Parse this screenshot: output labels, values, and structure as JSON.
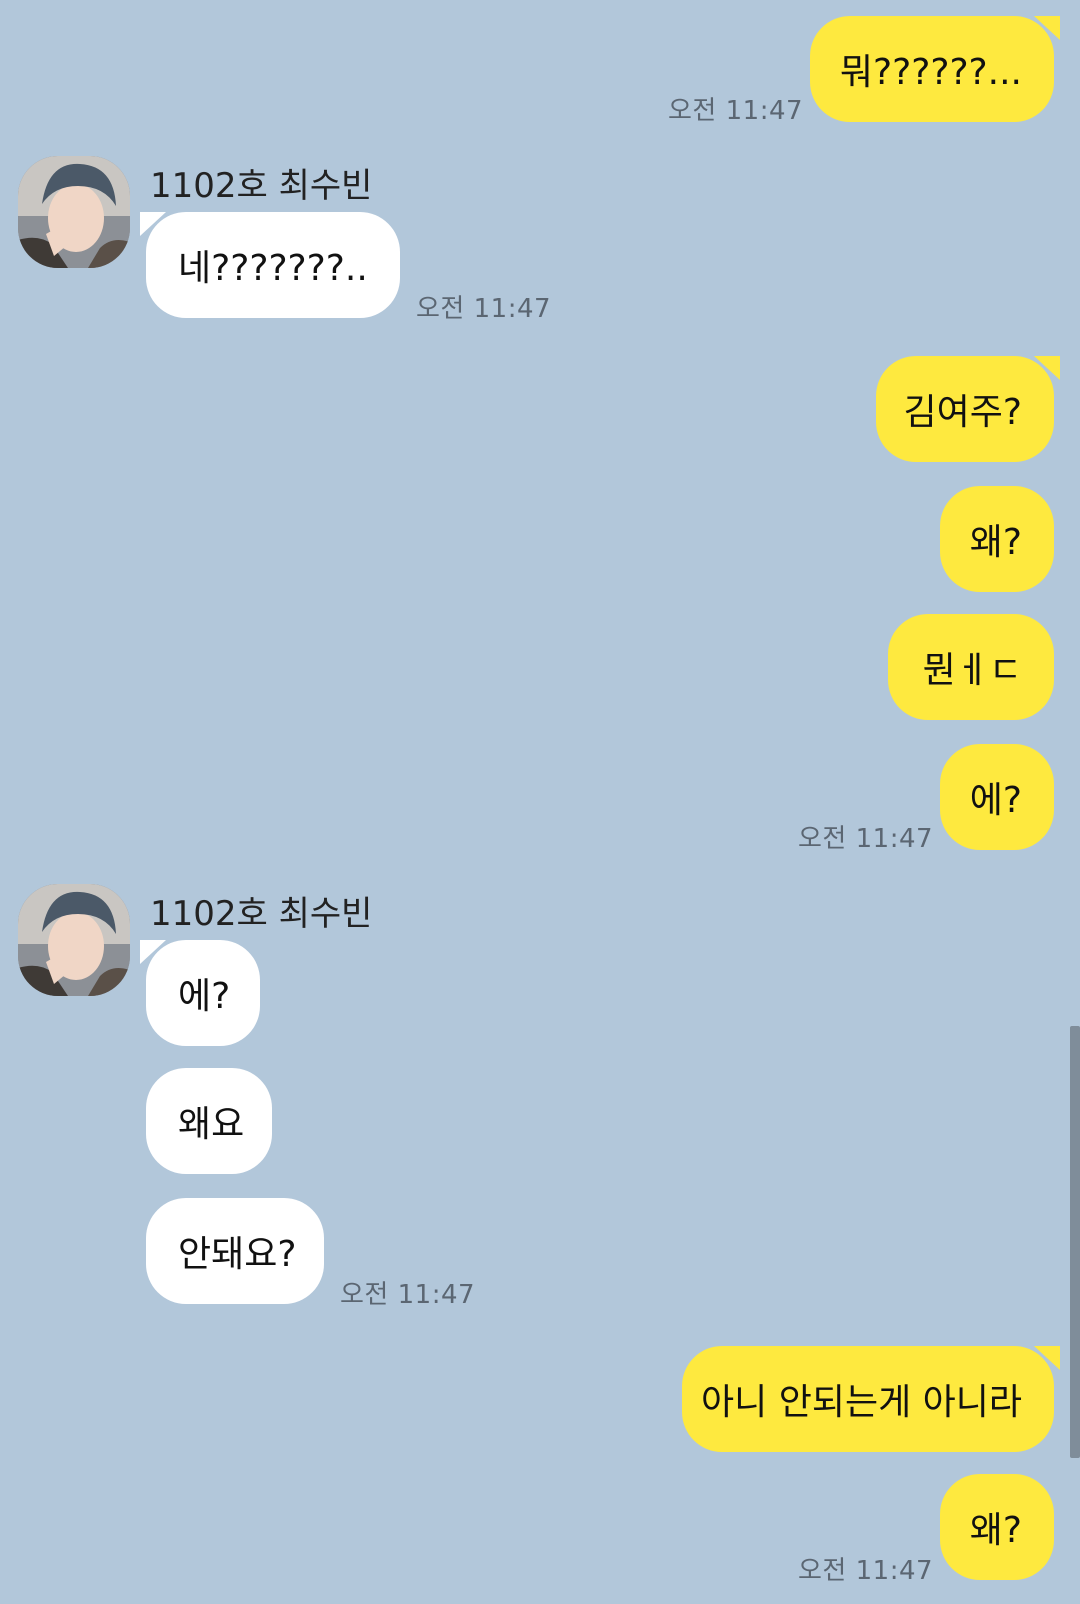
{
  "chat": {
    "sender_name": "1102호 최수빈",
    "messages": [
      {
        "id": "m1",
        "side": "me",
        "text": "뭐??????...",
        "time": "오전 11:47"
      },
      {
        "id": "m2",
        "side": "them",
        "text": "네???????..",
        "time": "오전 11:47"
      },
      {
        "id": "m3",
        "side": "me",
        "text": "김여주?",
        "time": ""
      },
      {
        "id": "m4",
        "side": "me",
        "text": "왜?",
        "time": ""
      },
      {
        "id": "m5",
        "side": "me",
        "text": "뭔ㅔㄷ",
        "time": ""
      },
      {
        "id": "m6",
        "side": "me",
        "text": "에?",
        "time": "오전 11:47"
      },
      {
        "id": "m7",
        "side": "them",
        "text": "에?",
        "time": ""
      },
      {
        "id": "m8",
        "side": "them",
        "text": "왜요",
        "time": ""
      },
      {
        "id": "m9",
        "side": "them",
        "text": "안돼요?",
        "time": "오전 11:47"
      },
      {
        "id": "m10",
        "side": "me",
        "text": "아니 안되는게 아니라",
        "time": ""
      },
      {
        "id": "m11",
        "side": "me",
        "text": "왜?",
        "time": "오전 11:47"
      }
    ]
  },
  "colors": {
    "background": "#b2c7da",
    "my_bubble": "#fee93f",
    "their_bubble": "#ffffff",
    "timestamp": "#5b6672"
  }
}
